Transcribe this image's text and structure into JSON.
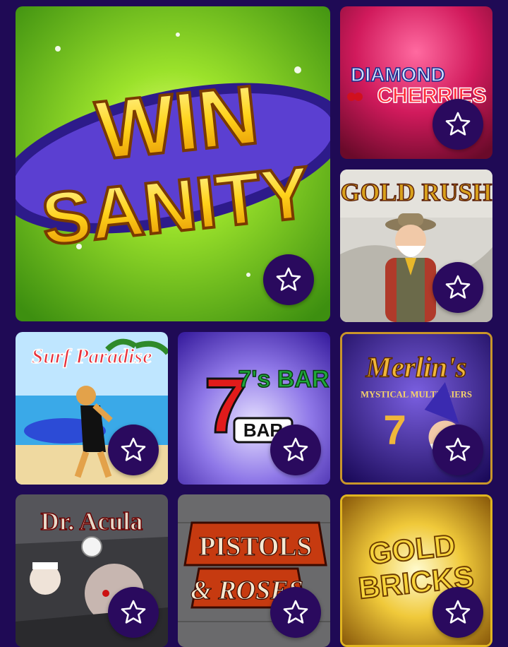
{
  "colors": {
    "background": "#1f0a55",
    "favorite_button": "#2a0a5e",
    "star_outline": "#ffffff"
  },
  "games": [
    {
      "title": "WIN SANITY",
      "line1": "WIN",
      "line2": "SANITY",
      "favorite_icon": "star-outline-icon"
    },
    {
      "title": "DIAMOND CHERRIES",
      "line1": "DIAMOND",
      "line2": "CHERRIES",
      "favorite_icon": "star-outline-icon"
    },
    {
      "title": "GOLD RUSH",
      "favorite_icon": "star-outline-icon"
    },
    {
      "title": "Surf Paradise",
      "favorite_icon": "star-outline-icon"
    },
    {
      "title": "7's BAR",
      "favorite_icon": "star-outline-icon"
    },
    {
      "title": "Merlin's Mystical Multipliers",
      "line1": "Merlin's",
      "line2": "MYSTICAL MULTIPLIERS",
      "favorite_icon": "star-outline-icon"
    },
    {
      "title": "Dr. Acula",
      "favorite_icon": "star-outline-icon"
    },
    {
      "title": "Pistols & Roses",
      "line1": "PISTOLS",
      "line2": "& ROSES",
      "favorite_icon": "star-outline-icon"
    },
    {
      "title": "Gold Bricks",
      "line1": "GOLD",
      "line2": "BRICKS",
      "favorite_icon": "star-outline-icon"
    }
  ]
}
